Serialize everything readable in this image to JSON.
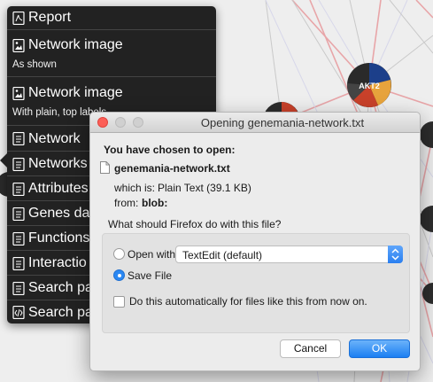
{
  "menu": {
    "items": [
      {
        "label": "Report",
        "sublabel": "",
        "icon": "pdf-icon"
      },
      {
        "label": "Network image",
        "sublabel": "As shown",
        "icon": "image-icon"
      },
      {
        "label": "Network image",
        "sublabel": "With plain, top labels",
        "icon": "image-icon"
      },
      {
        "label": "Network",
        "sublabel": "",
        "icon": "text-file-icon"
      },
      {
        "label": "Networks",
        "sublabel": "",
        "icon": "text-file-icon"
      },
      {
        "label": "Attributes",
        "sublabel": "",
        "icon": "text-file-icon"
      },
      {
        "label": "Genes da",
        "sublabel": "",
        "icon": "text-file-icon"
      },
      {
        "label": "Functions",
        "sublabel": "",
        "icon": "text-file-icon"
      },
      {
        "label": "Interactio",
        "sublabel": "",
        "icon": "text-file-icon"
      },
      {
        "label": "Search pa",
        "sublabel": "",
        "icon": "text-file-icon"
      },
      {
        "label": "Search pa",
        "sublabel": "",
        "icon": "code-file-icon"
      }
    ]
  },
  "network": {
    "nodes": [
      {
        "label": "AKT2",
        "colors": [
          "#1c3f8a",
          "#c8412a",
          "#e7a33c",
          "#444444"
        ]
      },
      {
        "label": "",
        "colors": [
          "#2a2a2a"
        ]
      },
      {
        "label": "",
        "colors": [
          "#2a2a2a"
        ]
      },
      {
        "label": "",
        "colors": [
          "#2a2a2a"
        ]
      }
    ],
    "edge_colors": [
      "#e8a5a8",
      "#d7d7ea",
      "#c9c9c9"
    ]
  },
  "dialog": {
    "title": "Opening genemania-network.txt",
    "intro": "You have chosen to open:",
    "filename": "genemania-network.txt",
    "which_is_label": "which is:",
    "which_is_value": "Plain Text (39.1 KB)",
    "from_label": "from:",
    "from_value": "blob:",
    "question": "What should Firefox do with this file?",
    "open_with_label": "Open with",
    "open_with_app": "TextEdit (default)",
    "save_file_label": "Save File",
    "save_file_selected": true,
    "auto_label": "Do this automatically for files like this from now on.",
    "auto_checked": false,
    "cancel_label": "Cancel",
    "ok_label": "OK"
  },
  "colors": {
    "menu_bg": "#222222",
    "accent_blue": "#2a88f3",
    "close_red": "#fc5f57"
  }
}
